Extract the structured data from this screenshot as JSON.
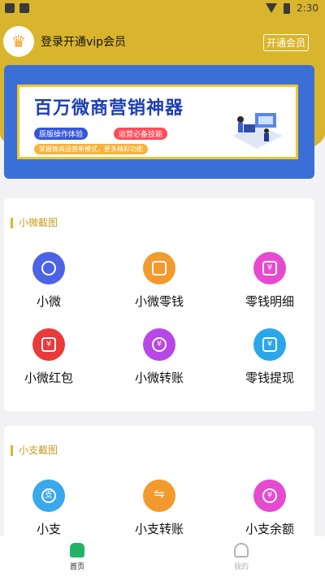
{
  "status_bar": {
    "time": "2:30"
  },
  "header": {
    "login_text": "登录开通vip会员",
    "vip_button": "开通会员"
  },
  "banner": {
    "title": "百万微商营销神器",
    "tag1": "原版操作体验",
    "tag2": "运营必备技能",
    "subtitle": "掌握微商运营新模式，更多精彩功能"
  },
  "section1": {
    "title": "小微截图",
    "items": [
      {
        "label": "小微",
        "color": "#4c63e6"
      },
      {
        "label": "小微零钱",
        "color": "#f39a2e"
      },
      {
        "label": "零钱明细",
        "color": "#e64ad0"
      },
      {
        "label": "小微红包",
        "color": "#ea3a3a"
      },
      {
        "label": "小微转账",
        "color": "#b847e8"
      },
      {
        "label": "零钱提现",
        "color": "#2aa7ec"
      }
    ]
  },
  "section2": {
    "title": "小支截图",
    "items": [
      {
        "label": "小支",
        "color": "#39a8ec"
      },
      {
        "label": "小支转账",
        "color": "#f39a2e"
      },
      {
        "label": "小支余额",
        "color": "#e64ad0"
      }
    ]
  },
  "nav": {
    "home": "首页",
    "mine": "我的"
  }
}
